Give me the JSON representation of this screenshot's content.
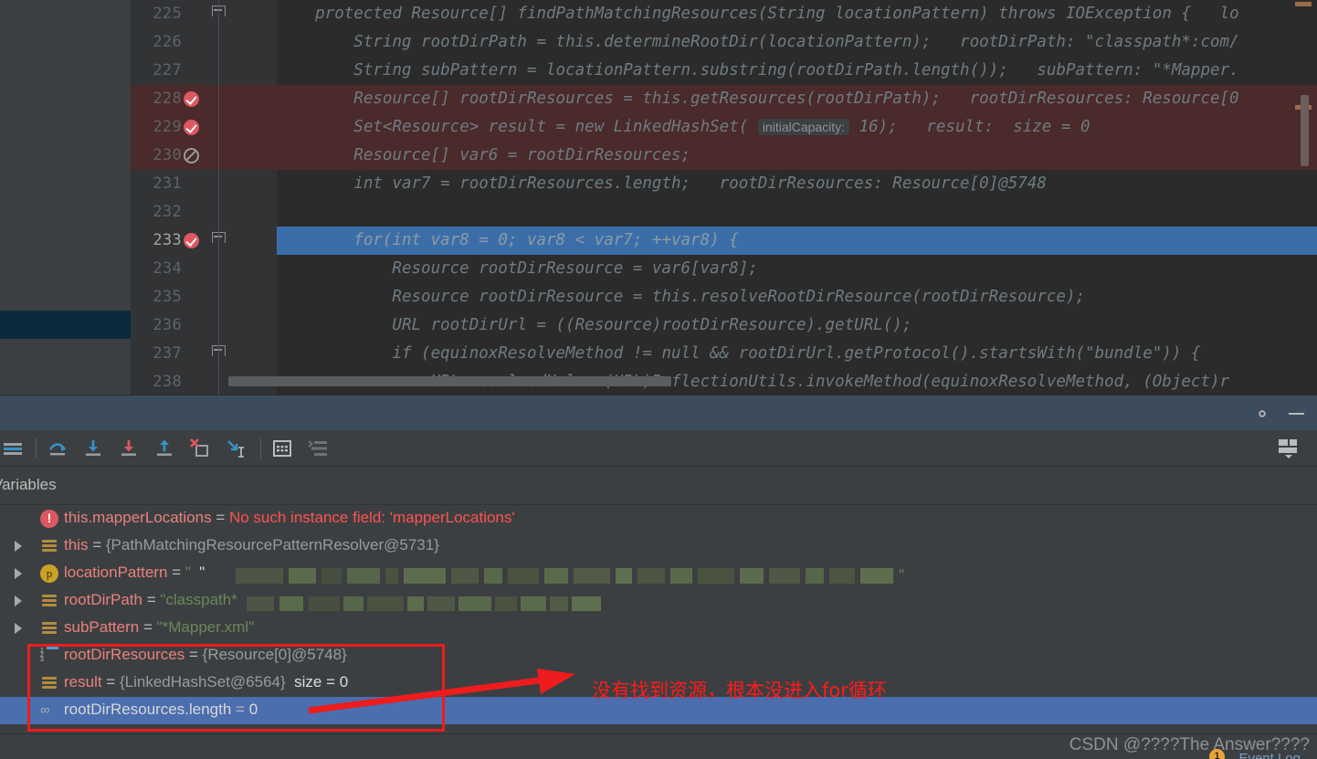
{
  "editor": {
    "lines": [
      {
        "num": "225",
        "fold": true,
        "bp": "",
        "hl": "",
        "text": "    protected Resource[] findPathMatchingResources(String locationPattern) throws IOException {   lo"
      },
      {
        "num": "226",
        "fold": false,
        "bp": "",
        "hl": "",
        "text": "        String rootDirPath = this.determineRootDir(locationPattern);   rootDirPath: \"classpath*:com/"
      },
      {
        "num": "227",
        "fold": false,
        "bp": "",
        "hl": "",
        "text": "        String subPattern = locationPattern.substring(rootDirPath.length());   subPattern: \"*Mapper."
      },
      {
        "num": "228",
        "fold": false,
        "bp": "valid",
        "hl": "red",
        "text": "        Resource[] rootDirResources = this.getResources(rootDirPath);   rootDirResources: Resource[0"
      },
      {
        "num": "229",
        "fold": false,
        "bp": "valid",
        "hl": "red",
        "text": "        Set<Resource> result = new LinkedHashSet( initialCapacity: 16);   result:  size = 0"
      },
      {
        "num": "230",
        "fold": false,
        "bp": "muted",
        "hl": "red",
        "text": "        Resource[] var6 = rootDirResources;"
      },
      {
        "num": "231",
        "fold": false,
        "bp": "",
        "hl": "",
        "text": "        int var7 = rootDirResources.length;   rootDirResources: Resource[0]@5748"
      },
      {
        "num": "232",
        "fold": false,
        "bp": "",
        "hl": "",
        "text": ""
      },
      {
        "num": "233",
        "fold": true,
        "bp": "valid",
        "hl": "sel",
        "text": "        for(int var8 = 0; var8 < var7; ++var8) {"
      },
      {
        "num": "234",
        "fold": false,
        "bp": "",
        "hl": "",
        "text": "            Resource rootDirResource = var6[var8];"
      },
      {
        "num": "235",
        "fold": false,
        "bp": "",
        "hl": "",
        "text": "            Resource rootDirResource = this.resolveRootDirResource(rootDirResource);"
      },
      {
        "num": "236",
        "fold": false,
        "bp": "",
        "hl": "",
        "text": "            URL rootDirUrl = ((Resource)rootDirResource).getURL();"
      },
      {
        "num": "237",
        "fold": true,
        "bp": "",
        "hl": "",
        "text": "            if (equinoxResolveMethod != null && rootDirUrl.getProtocol().startsWith(\"bundle\")) {"
      },
      {
        "num": "238",
        "fold": false,
        "bp": "",
        "hl": "",
        "text": "                URL resolvedUrl = (URL)ReflectionUtils.invokeMethod(equinoxResolveMethod, (Object)r"
      }
    ],
    "inline_hints": {
      "line226": "rootDirPath: \"classpath*:com/",
      "line227": "subPattern: \"*Mapper.",
      "line228": "rootDirResources: Resource[0",
      "line229_param": "initialCapacity:",
      "line229_result": "result:  size = 0",
      "line231": "rootDirResources: Resource[0]@5748",
      "line225": "lo"
    }
  },
  "debug_window": {
    "title_buttons": {
      "settings": "gear-icon",
      "minimize": "minimize-icon"
    },
    "toolbar": [
      {
        "name": "show-execution-point",
        "tooltip": "Show Execution Point"
      },
      {
        "name": "step-over",
        "tooltip": "Step Over"
      },
      {
        "name": "step-into",
        "tooltip": "Step Into"
      },
      {
        "name": "force-step-into",
        "tooltip": "Force Step Into"
      },
      {
        "name": "step-out",
        "tooltip": "Step Out"
      },
      {
        "name": "drop-frame",
        "tooltip": "Drop Frame"
      },
      {
        "name": "run-to-cursor",
        "tooltip": "Run to Cursor"
      },
      {
        "name": "evaluate-expression",
        "tooltip": "Evaluate Expression"
      },
      {
        "name": "settings-layout",
        "tooltip": "Layout Settings"
      }
    ],
    "tab_label": "Variables"
  },
  "variables": [
    {
      "icon": "error-icon",
      "expandable": false,
      "selected": false,
      "name": "this.mapperLocations",
      "eq": " = ",
      "value": "No such instance field: 'mapperLocations'",
      "value_kind": "error",
      "extra": ""
    },
    {
      "icon": "field-icon",
      "expandable": true,
      "selected": false,
      "name": "this",
      "eq": " = ",
      "value": "{PathMatchingResourcePatternResolver@5731}",
      "value_kind": "ref",
      "extra": ""
    },
    {
      "icon": "param-icon",
      "expandable": true,
      "selected": false,
      "name": "locationPattern",
      "eq": " = ",
      "value": "\"",
      "value_kind": "censored",
      "extra": "\""
    },
    {
      "icon": "field-icon",
      "expandable": true,
      "selected": false,
      "name": "rootDirPath",
      "eq": " = ",
      "value": "\"classpath*",
      "value_kind": "censored2",
      "extra": ""
    },
    {
      "icon": "field-icon",
      "expandable": true,
      "selected": false,
      "name": "subPattern",
      "eq": " = ",
      "value": "\"*Mapper.xml\"",
      "value_kind": "string",
      "extra": ""
    },
    {
      "icon": "array-icon",
      "expandable": false,
      "selected": false,
      "name": "rootDirResources",
      "eq": " = ",
      "value": "{Resource[0]@5748}",
      "value_kind": "ref",
      "extra": ""
    },
    {
      "icon": "field-icon",
      "expandable": false,
      "selected": false,
      "name": "result",
      "eq": " = ",
      "value": "{LinkedHashSet@6564}",
      "value_kind": "ref",
      "extra": "size = 0"
    },
    {
      "icon": "watch-icon",
      "expandable": false,
      "selected": true,
      "name": "rootDirResources.length",
      "eq": " = ",
      "value": "0",
      "value_kind": "num",
      "extra": ""
    }
  ],
  "annotation": {
    "text": "没有找到资源，根本没进入for循环",
    "color": "#ff1a1a",
    "box_color": "#ee1c1c"
  },
  "status_bar": {
    "watermark": "CSDN @????The Answer????",
    "event_log_label": "Event Log",
    "event_log_count": "1"
  },
  "colors": {
    "editor_bg": "#2b2b2b",
    "gutter_bg": "#313335",
    "panel_bg": "#3c3f41",
    "selection_blue": "#3b6ea8",
    "tree_selection": "#4b6eaf",
    "breakpoint_red": "#db5860",
    "error_red": "#ff5252",
    "string_green": "#6a8759",
    "keyword_orange": "#cc7832",
    "number_blue": "#6897bb",
    "header_blue": "#3c4c5c",
    "var_name_red": "#e8827e",
    "badge_orange": "#e8a33d"
  }
}
